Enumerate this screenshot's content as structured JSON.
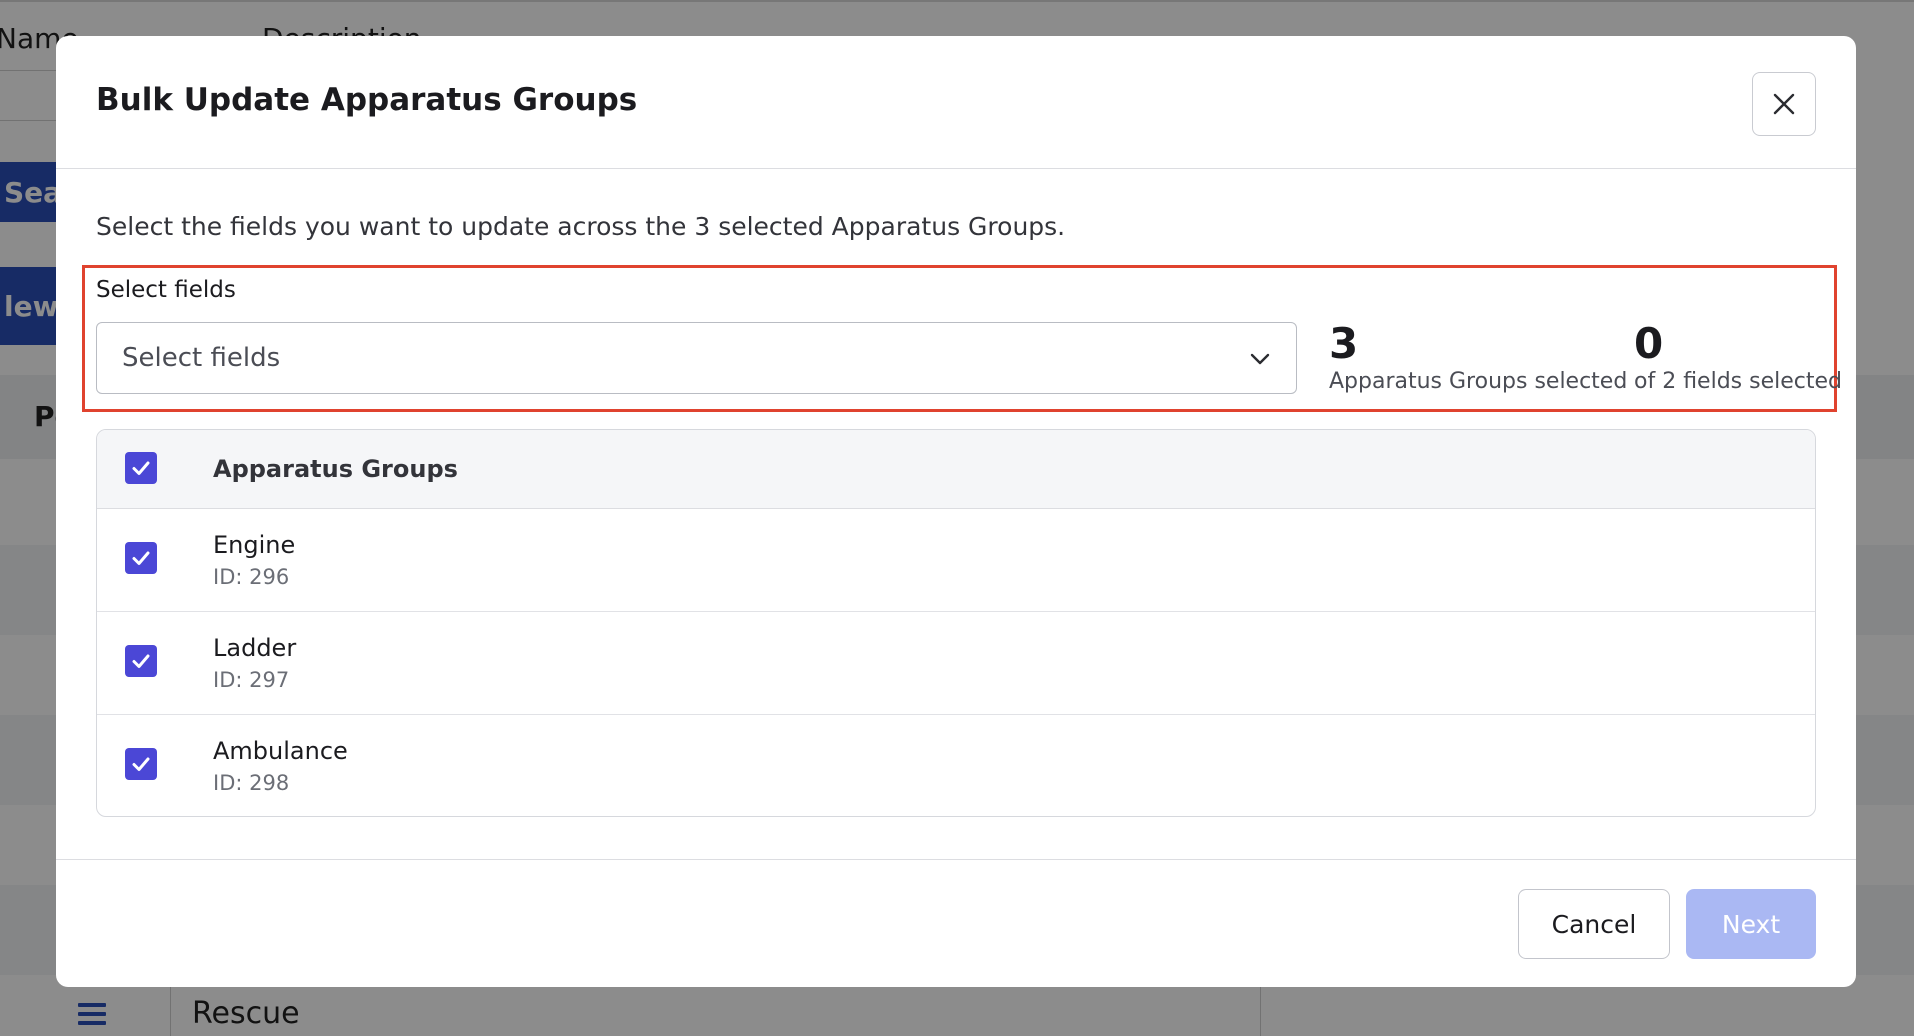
{
  "background": {
    "column_name": "Name",
    "column_description": "Description",
    "search_button": "Sear",
    "new_button": "lew",
    "column_p": "Pe",
    "row_rescue": "Rescue"
  },
  "modal": {
    "title": "Bulk Update Apparatus Groups",
    "intro": "Select the fields you want to update across the 3 selected Apparatus Groups.",
    "select": {
      "label": "Select fields",
      "placeholder": "Select fields"
    },
    "stats": [
      {
        "value": "3",
        "label": "Apparatus Groups selected"
      },
      {
        "value": "0",
        "label": "of 2 fields selected"
      }
    ],
    "list": {
      "header": "Apparatus Groups",
      "header_checked": true,
      "items": [
        {
          "name": "Engine",
          "id": "ID: 296",
          "checked": true
        },
        {
          "name": "Ladder",
          "id": "ID: 297",
          "checked": true
        },
        {
          "name": "Ambulance",
          "id": "ID: 298",
          "checked": true
        }
      ]
    },
    "footer": {
      "cancel_label": "Cancel",
      "next_label": "Next"
    }
  },
  "colors": {
    "accent": "#4b47d6",
    "next_disabled": "#aab8f3",
    "highlight_border": "#e0432f"
  },
  "icons": {
    "close": "close-icon",
    "dropdown": "chevron-down-icon",
    "check": "checkmark-icon",
    "menu": "hamburger-icon"
  }
}
